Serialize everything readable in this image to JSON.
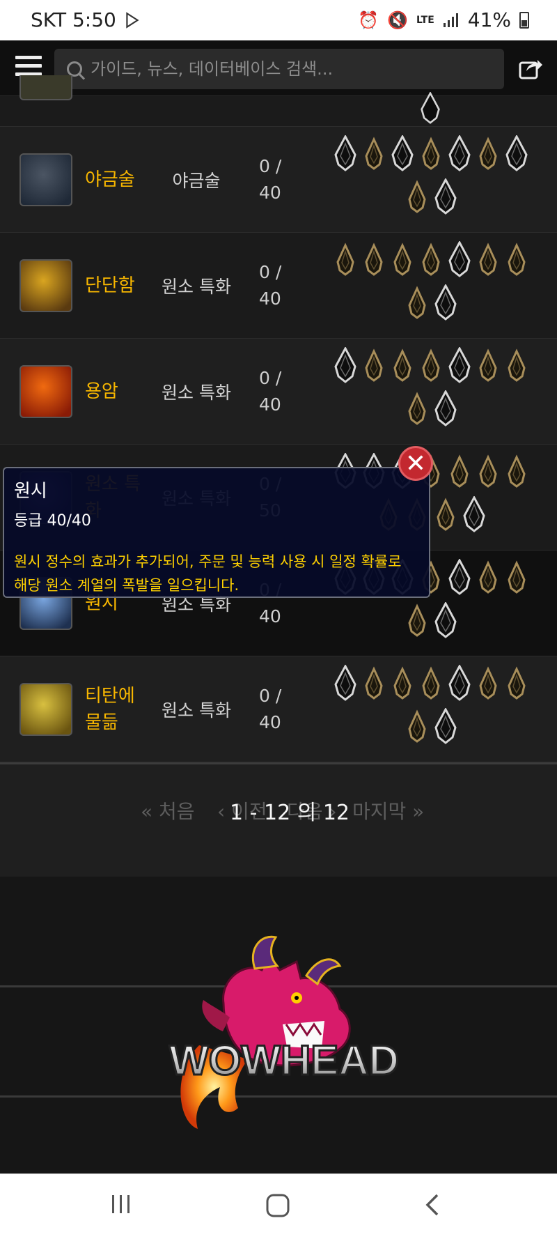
{
  "status_bar": {
    "carrier_time": "SKT 5:50",
    "battery": "41%"
  },
  "search": {
    "placeholder": "가이드, 뉴스, 데이터베이스 검색..."
  },
  "talents": [
    {
      "name": "야금술",
      "type": "야금술",
      "rank": "0 / 40",
      "icon": "metal-ingot-icon",
      "icon_colors": [
        "#4b5563",
        "#1f2937"
      ]
    },
    {
      "name": "단단함",
      "type": "원소 특화",
      "rank": "0 / 40",
      "icon": "stone-fist-icon",
      "icon_colors": [
        "#d9a520",
        "#5a3a10"
      ]
    },
    {
      "name": "용암",
      "type": "원소 특화",
      "rank": "0 / 40",
      "icon": "lava-spirit-icon",
      "icon_colors": [
        "#f06a10",
        "#8a1b06"
      ]
    },
    {
      "name": "원소 특화",
      "type": "원소 특화",
      "rank": "0 / 50",
      "icon": "elemental-icon",
      "icon_colors": [
        "#5a4a9a",
        "#1a1a3a"
      ]
    },
    {
      "name": "원시",
      "type": "원소 특화",
      "rank": "0 / 40",
      "icon": "primal-storm-icon",
      "icon_colors": [
        "#7aa6e0",
        "#1e3050"
      ]
    },
    {
      "name": "티탄에 물듦",
      "type": "원소 특화",
      "rank": "0 / 40",
      "icon": "titan-infused-icon",
      "icon_colors": [
        "#d8c040",
        "#6a5410"
      ]
    }
  ],
  "tooltip": {
    "title": "원시",
    "rank": "등급 40/40",
    "description": "원시 정수의 효과가 추가되어, 주문 및 능력 사용 시 일정 확률로 해당 원소 계열의 폭발을 일으킵니다."
  },
  "pagination": {
    "first": "« 처음",
    "prev": "‹ 이전",
    "count": "1 - 12 의 12",
    "next": "다음 ›",
    "last": "마지막 »"
  },
  "footer": {
    "logo_text": "WOWHEAD"
  }
}
